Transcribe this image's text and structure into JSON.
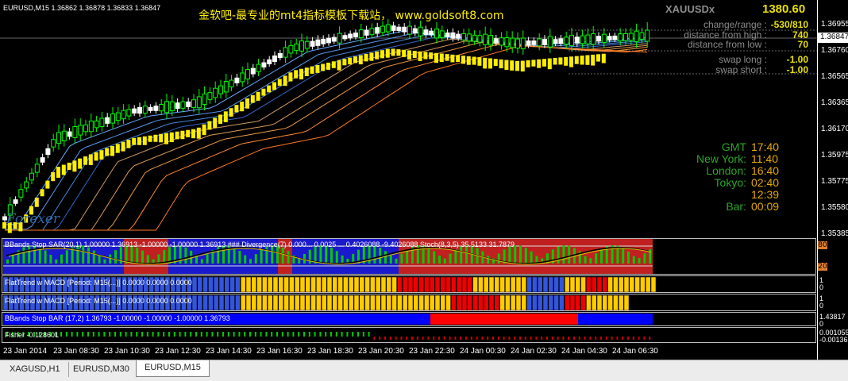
{
  "window": {
    "symbol_header": "EURUSD,M15  1.36862 1.36878 1.36833 1.36847",
    "watermark": "金软吧-最专业的mt4指标模板下载站，   www.goldsoft8.com",
    "logo_text": "Forexer"
  },
  "info_panel": {
    "symbol": "XAUUSDx",
    "price": "1380.60",
    "rows": [
      {
        "label": "change/range :",
        "value": "-530/810"
      },
      {
        "label": "distance from high :",
        "value": "740"
      },
      {
        "label": "distance from low :",
        "value": "70"
      },
      {
        "label": "swap long :",
        "value": "-1.00"
      },
      {
        "label": "swap short :",
        "value": "-1.00"
      }
    ]
  },
  "clocks": [
    {
      "label": "GMT",
      "value": "17:40"
    },
    {
      "label": "New York:",
      "value": "11:40"
    },
    {
      "label": "London:",
      "value": "16:40"
    },
    {
      "label": "Tokyo:",
      "value": "02:40"
    },
    {
      "label": "",
      "value": "12:39"
    },
    {
      "label": "Bar:",
      "value": "00:09"
    }
  ],
  "price_axis": [
    "1.36955",
    "1.36847",
    "1.36760",
    "1.36565",
    "1.36365",
    "1.36170",
    "1.35975",
    "1.35775",
    "1.35580",
    "1.35385"
  ],
  "current_price": "1.36847",
  "time_axis": [
    "23 Jan 2014",
    "23 Jan 08:30",
    "23 Jan 10:30",
    "23 Jan 12:30",
    "23 Jan 14:30",
    "23 Jan 16:30",
    "23 Jan 18:30",
    "23 Jan 20:30",
    "23 Jan 22:30",
    "24 Jan 00:30",
    "24 Jan 02:30",
    "24 Jan 04:30",
    "24 Jan 06:30"
  ],
  "indicators": {
    "stoch_panel": {
      "title": "BBands Stop SAR(20,1) 1.00000 1.36913 -1.00000 -1.00000 1.36913 ###  Divergence(7) 0.000... 0.0025 ... 0.4026088 -9.4026088  Stoch(8,3,5) 35.5133 31.7879",
      "level_high": "80",
      "level_low": "20"
    },
    "flat1": {
      "title": "FlatTrend w MACD [Period: M15(...)] 0.0000 0.0000 0.0000",
      "axis_top": "1",
      "axis_bottom": "0"
    },
    "flat2": {
      "title": "FlatTrend w MACD [Period: M15(...)] 0.0000 0.0000 0.0000",
      "axis_top": "1",
      "axis_bottom": "0"
    },
    "bbands_bar": {
      "title": "BBands Stop BAR (17,2) 1.36793 -1.00000 -1.00000 -1.00000 1.36793",
      "axis_top": "1.43817",
      "axis_bottom": "0"
    },
    "fisher": {
      "title": "Fisher -0.128601",
      "axis_top": "0.001055",
      "axis_bottom": "-0.00136"
    }
  },
  "tabs": [
    {
      "label": "XAGUSD,H1",
      "active": false
    },
    {
      "label": "EURUSD,M30",
      "active": false
    },
    {
      "label": "EURUSD,M15",
      "active": true
    }
  ],
  "colors": {
    "bull_candle": "#00ff00",
    "bear_candle": "#ffffff",
    "trend_bar": "#ffee00",
    "fast_ma": "#3399ff",
    "slow_ma": "#ff9933",
    "stoch_bg_red": "#c02020",
    "stoch_bg_blue": "#1a1acc",
    "flat_blue": "#3355dd",
    "flat_yellow": "#ffcc00",
    "flat_red": "#ee0000"
  }
}
